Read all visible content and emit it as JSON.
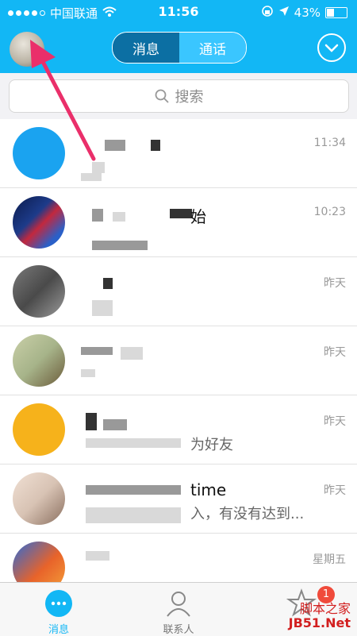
{
  "status_bar": {
    "carrier": "中国联通",
    "time": "11:56",
    "battery": "43%",
    "battery_level": 0.43
  },
  "header": {
    "tabs": [
      "消息",
      "通话"
    ],
    "active_tab": 0
  },
  "search": {
    "placeholder": "搜索"
  },
  "conversations": [
    {
      "time": "11:34",
      "title_visible": "",
      "preview_visible": "",
      "avatar_color": "#1aa3f0"
    },
    {
      "time": "10:23",
      "title_visible": "始",
      "preview_visible": "",
      "avatar_color": "#1d3b8a"
    },
    {
      "time": "昨天",
      "title_visible": "",
      "preview_visible": "",
      "avatar_color": "#5a5a5a"
    },
    {
      "time": "昨天",
      "title_visible": "",
      "preview_visible": "",
      "avatar_color": "#a7b48a"
    },
    {
      "time": "昨天",
      "title_visible": "",
      "preview_visible": "为好友",
      "avatar_color": "#f6b21b"
    },
    {
      "time": "昨天",
      "title_visible": "time",
      "preview_visible": "入，有没有达到...",
      "avatar_color": "#d8c3b4"
    },
    {
      "time": "星期五",
      "title_visible": "",
      "preview_visible": "",
      "avatar_color": "#e8632a"
    }
  ],
  "tab_bar": {
    "messages_label": "消息",
    "contacts_label": "联系人",
    "dynamic_badge": "1"
  },
  "watermark": {
    "line1": "脚本之家",
    "line2": "JB51.Net"
  },
  "colors": {
    "accent": "#12b7f5",
    "badge": "#f04b3b",
    "annotation_arrow": "#ea2f6a"
  }
}
